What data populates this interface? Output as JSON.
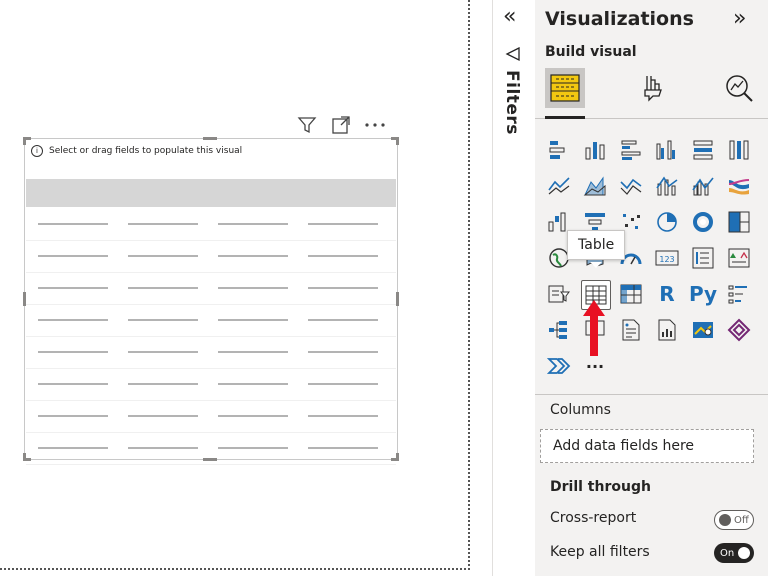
{
  "canvas": {
    "visual_hint": "Select or drag fields to populate this visual"
  },
  "filters": {
    "label": "Filters"
  },
  "visualizations": {
    "title": "Visualizations",
    "build_visual_label": "Build visual",
    "tooltip": "Table",
    "more_label": "···",
    "colors": {
      "accent_yellow": "#F2C811",
      "icon_blue": "#1F6FB5",
      "arrow_red": "#E81123"
    }
  },
  "fields": {
    "columns_label": "Columns",
    "placeholder": "Add data fields here"
  },
  "drill_through": {
    "title": "Drill through",
    "cross_report": {
      "label": "Cross-report",
      "state": "Off"
    },
    "keep_filters": {
      "label": "Keep all filters",
      "state": "On"
    }
  }
}
